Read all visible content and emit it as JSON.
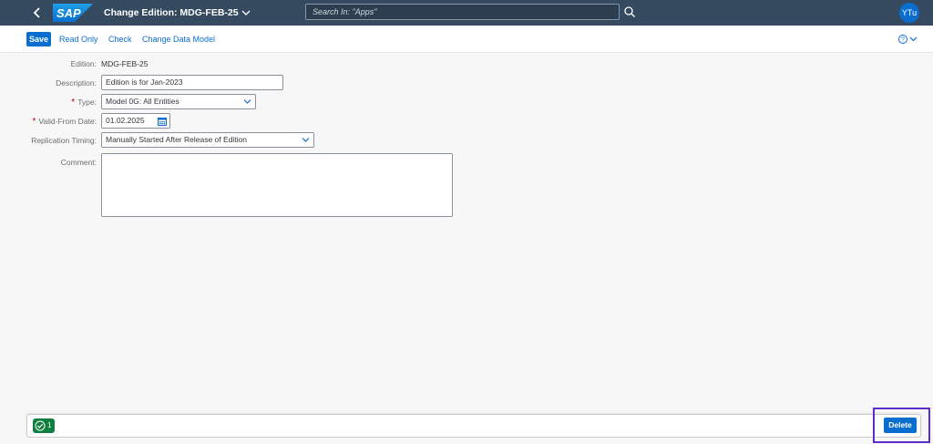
{
  "shell": {
    "back_icon": "back-chevron-icon",
    "logo_text": "SAP",
    "app_title": "Change Edition: MDG-FEB-25",
    "search_placeholder": "Search In: \"Apps\"",
    "avatar_initials": "YTu",
    "colors": {
      "shell_bg": "#354a5f",
      "accent": "#0a6ed1"
    }
  },
  "toolbar": {
    "save_label": "Save",
    "read_only_label": "Read Only",
    "check_label": "Check",
    "change_data_model_label": "Change Data Model",
    "help_icon": "help-icon"
  },
  "form": {
    "edition": {
      "label": "Edition:",
      "value": "MDG-FEB-25"
    },
    "description": {
      "label": "Description:",
      "value": "Edition is for Jan-2023"
    },
    "type": {
      "required_mark": "*",
      "label": "Type:",
      "value": "Model 0G: All Entities"
    },
    "valid_from": {
      "required_mark": "*",
      "label": "Valid-From Date:",
      "value": "01.02.2025"
    },
    "replication_timing": {
      "label": "Replication Timing:",
      "value": "Manually Started After Release of Edition"
    },
    "comment": {
      "label": "Comment:",
      "value": ""
    }
  },
  "footer": {
    "message_count": "1",
    "message_icon": "success-check-icon",
    "delete_label": "Delete",
    "colors": {
      "message_badge": "#107e3e",
      "highlight": "#5b2dcc"
    }
  }
}
